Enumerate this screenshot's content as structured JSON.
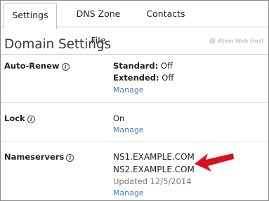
{
  "tabs": [
    {
      "label": "Settings",
      "active": true
    },
    {
      "label": "DNS Zone File",
      "active": false
    },
    {
      "label": "Contacts",
      "active": false
    }
  ],
  "page_title": "Domain Settings",
  "watermark": "Atom Web Host",
  "info_glyph": "i",
  "auto_renew": {
    "label": "Auto-Renew",
    "standard_label": "Standard:",
    "standard_value": "Off",
    "extended_label": "Extended:",
    "extended_value": "Off",
    "manage": "Manage"
  },
  "lock": {
    "label": "Lock",
    "value": "On",
    "manage": "Manage"
  },
  "nameservers": {
    "label": "Nameservers",
    "servers": [
      "NS1.EXAMPLE.COM",
      "NS2.EXAMPLE.COM"
    ],
    "updated": "Updated 12/5/2014",
    "manage": "Manage"
  },
  "colors": {
    "link": "#3d7ab8",
    "arrow": "#d8121b",
    "muted_text": "#777777"
  }
}
